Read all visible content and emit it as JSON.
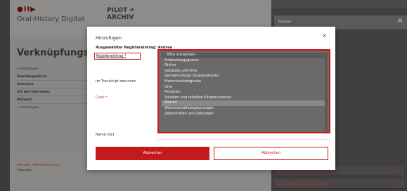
{
  "background": {
    "logo_icons": "●II▶",
    "logo_text": "Oral-History Digital",
    "pilot_line1": "PILOT ✈",
    "pilot_line2": "ARCHIV",
    "page_title": "Verknüpfungsart",
    "side_items": [
      {
        "label": "+ Hinzufügen",
        "plain": true
      },
      {
        "label": "Zweitbiografisch",
        "plain": false
      },
      {
        "label": "Interview",
        "plain": false
      },
      {
        "label": "Ort des Interviews",
        "plain": false
      },
      {
        "label": "Wohnort",
        "plain": false
      },
      {
        "label": "+ Hinzufügen",
        "plain": true
      }
    ],
    "footer_link": "Interview · Verknüpfungsarten",
    "footer_text": "Filtweite",
    "right_search": "Register",
    "right_rows": [
      "VERKNÜPFUNGSARTEN BEARBEITEN",
      "VERKNÜPFUNGSARTEN BEARBEITEN"
    ]
  },
  "modal": {
    "title": "Hinzufügen",
    "close": "×",
    "subtitle": "Ausgewählter Registereintrag: Andrea",
    "label_registereintrag": "Registereintrag *",
    "label_transcript": "Im Transkript benutzen",
    "label_code": "Code *",
    "label_name": "Name (de)",
    "options": [
      "- Bitte auswählen -",
      "Erlebnisbegegnisse",
      "Fächer",
      "Gebäude und Orte",
      "Gemeinnützige Organisationen",
      "Menschenkategorien",
      "Orte",
      "Personen",
      "Sozialen und religiöse Eingebundenen",
      "Warum",
      "Wissenschaftsbegegnungen",
      "Zeitschriften und Zeitungen"
    ],
    "selected_index": 9,
    "add_label": "Abbrechen",
    "cancel_label": "Abbrechen"
  }
}
